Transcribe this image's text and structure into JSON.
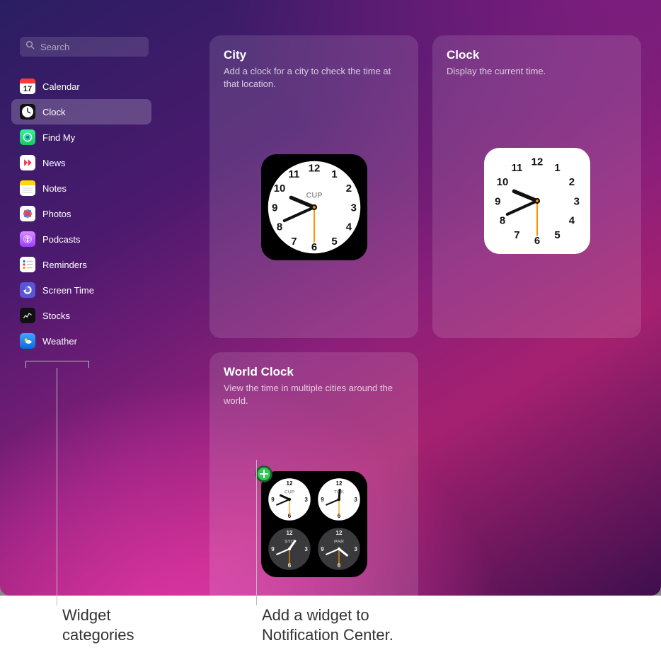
{
  "search": {
    "placeholder": "Search"
  },
  "sidebar": {
    "items": [
      {
        "label": "Calendar",
        "selected": false
      },
      {
        "label": "Clock",
        "selected": true
      },
      {
        "label": "Find My",
        "selected": false
      },
      {
        "label": "News",
        "selected": false
      },
      {
        "label": "Notes",
        "selected": false
      },
      {
        "label": "Photos",
        "selected": false
      },
      {
        "label": "Podcasts",
        "selected": false
      },
      {
        "label": "Reminders",
        "selected": false
      },
      {
        "label": "Screen Time",
        "selected": false
      },
      {
        "label": "Stocks",
        "selected": false
      },
      {
        "label": "Weather",
        "selected": false
      }
    ]
  },
  "cards": {
    "city": {
      "title": "City",
      "desc": "Add a clock for a city to check the time at that location.",
      "code": "CUP"
    },
    "clock": {
      "title": "Clock",
      "desc": "Display the current time."
    },
    "world": {
      "title": "World Clock",
      "desc": "View the time in multiple cities around the world.",
      "cities": [
        {
          "code": "CUP"
        },
        {
          "code": "TOK"
        },
        {
          "code": "SYD"
        },
        {
          "code": "PAR"
        }
      ]
    }
  },
  "annotations": {
    "categories": "Widget\ncategories",
    "add": "Add a widget to\nNotification Center."
  }
}
